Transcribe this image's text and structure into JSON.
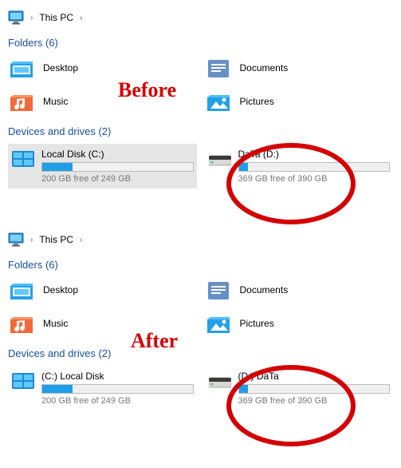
{
  "annotations": {
    "before": "Before",
    "after": "After"
  },
  "panes": [
    {
      "breadcrumb": {
        "label": "This PC"
      },
      "folders_header": "Folders (6)",
      "folders": [
        {
          "name": "Desktop",
          "icon": "desktop"
        },
        {
          "name": "Documents",
          "icon": "documents"
        },
        {
          "name": "Music",
          "icon": "music"
        },
        {
          "name": "Pictures",
          "icon": "pictures"
        }
      ],
      "drives_header": "Devices and drives (2)",
      "drives": [
        {
          "name": "Local Disk (C:)",
          "status": "200 GB free of 249 GB",
          "used_pct": 20,
          "type": "system",
          "selected": true
        },
        {
          "name": "DaTa (D:)",
          "status": "369 GB free of 390 GB",
          "used_pct": 6,
          "type": "disk",
          "selected": false,
          "circled": true
        }
      ]
    },
    {
      "breadcrumb": {
        "label": "This PC"
      },
      "folders_header": "Folders (6)",
      "folders": [
        {
          "name": "Desktop",
          "icon": "desktop"
        },
        {
          "name": "Documents",
          "icon": "documents"
        },
        {
          "name": "Music",
          "icon": "music"
        },
        {
          "name": "Pictures",
          "icon": "pictures"
        }
      ],
      "drives_header": "Devices and drives (2)",
      "drives": [
        {
          "name": "(C:) Local Disk",
          "status": "200 GB free of 249 GB",
          "used_pct": 20,
          "type": "system",
          "selected": false
        },
        {
          "name": "(D:) DaTa",
          "status": "369 GB free of 390 GB",
          "used_pct": 6,
          "type": "disk",
          "selected": false,
          "circled": true
        }
      ]
    }
  ]
}
